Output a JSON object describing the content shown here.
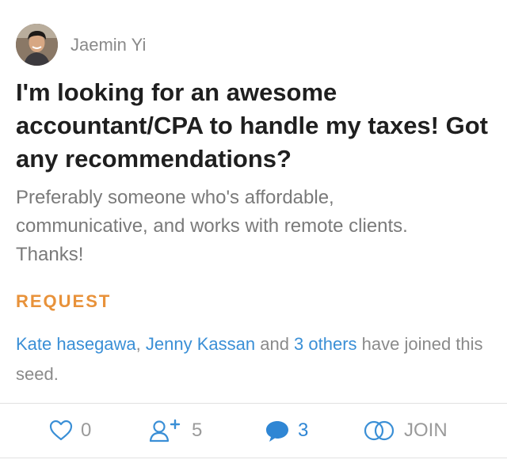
{
  "post": {
    "author": {
      "name": "Jaemin Yi"
    },
    "title": "I'm looking for an awesome accountant/CPA to handle my taxes! Got any recommendations?",
    "body": "Preferably someone who's affordable, communicative, and works with remote clients. Thanks!",
    "tag": "REQUEST",
    "joined": {
      "user1": "Kate hasegawa",
      "sep": ", ",
      "user2": "Jenny Kassan",
      "and": " and ",
      "others": "3 others",
      "suffix": " have joined this seed."
    }
  },
  "actions": {
    "likes": "0",
    "members": "5",
    "comments": "3",
    "join_label": "JOIN"
  },
  "colors": {
    "accent_orange": "#e8923a",
    "link_blue": "#3a8fd6",
    "comment_blue": "#2f86d4"
  },
  "icons": [
    "heart-icon",
    "add-person-icon",
    "speech-bubble-icon",
    "interlocking-rings-icon"
  ]
}
